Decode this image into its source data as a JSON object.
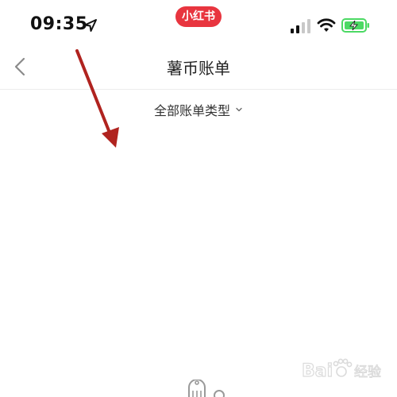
{
  "status_bar": {
    "time": "09:35",
    "app_badge": "小红书",
    "location_icon": "location-arrow-icon",
    "signal_icon": "cellular-signal-icon",
    "wifi_icon": "wifi-icon",
    "battery_icon": "battery-charging-icon",
    "battery_color": "#4cd964",
    "badge_color": "#e8353f"
  },
  "nav": {
    "title": "薯币账单",
    "back_icon": "chevron-left-icon"
  },
  "filter": {
    "label": "全部账单类型",
    "icon": "chevron-down-icon"
  },
  "annotation": {
    "arrow_color": "#b0231f"
  },
  "watermark": {
    "text": "Bai经验",
    "icon": "baidu-paw-icon"
  }
}
